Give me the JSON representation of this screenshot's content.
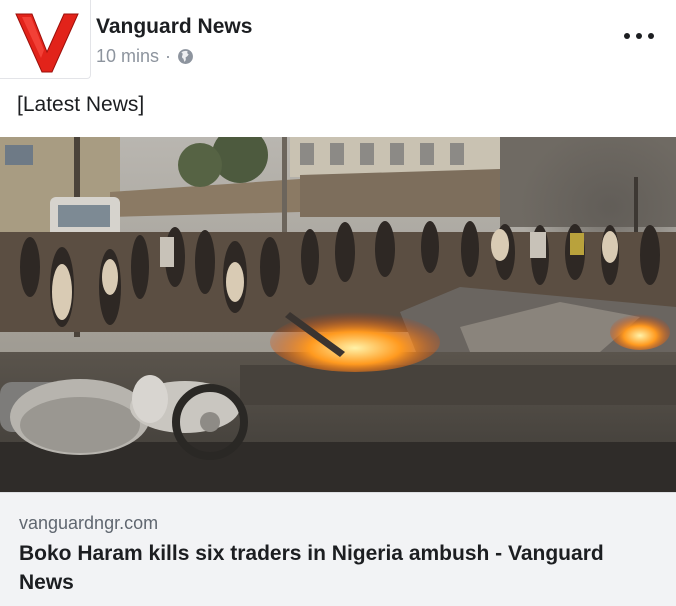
{
  "post": {
    "page_name": "Vanguard News",
    "timestamp": "10 mins",
    "separator": "·",
    "privacy_icon": "globe-icon",
    "more_icon": "more-options-icon",
    "text": "[Latest News]"
  },
  "brand": {
    "logo_letter": "V",
    "logo_color": "#e2231a"
  },
  "link_preview": {
    "image": "photo of burning debris and crowd on a street with damaged motorcycles",
    "domain": "vanguardngr.com",
    "title": "Boko Haram kills six traders in Nigeria ambush - Vanguard News"
  }
}
